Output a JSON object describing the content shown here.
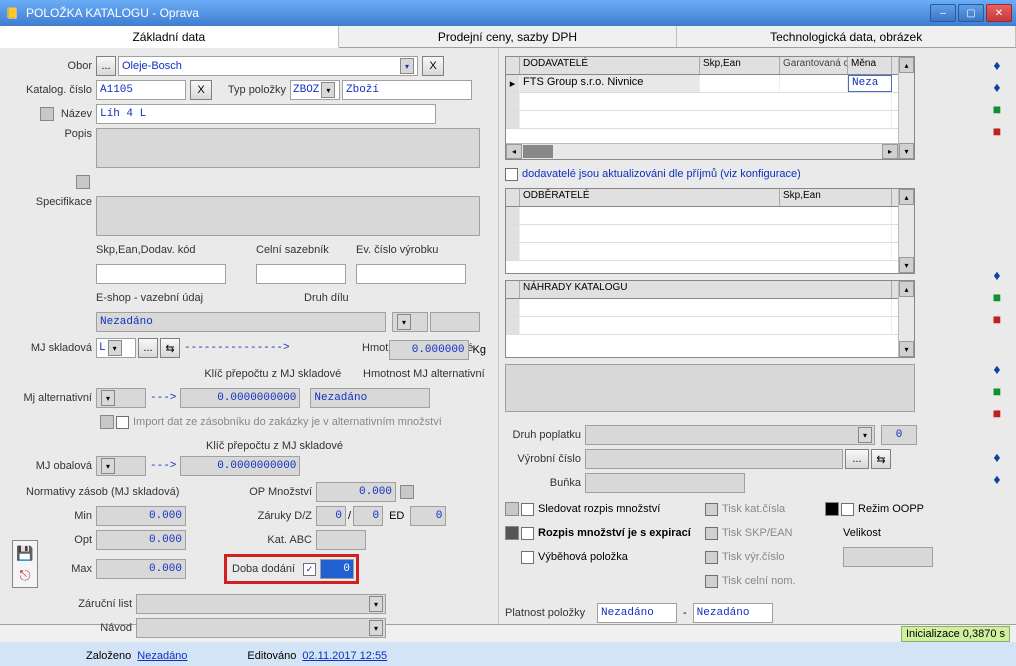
{
  "window": {
    "title": "POLOŽKA KATALOGU - Oprava",
    "min": "–",
    "max": "▢",
    "close": "✕"
  },
  "tabs": {
    "t1": "Základní data",
    "t2": "Prodejní ceny, sazby DPH",
    "t3": "Technologická data, obrázek"
  },
  "left": {
    "obor_lbl": "Obor",
    "obor_btn": "...",
    "obor_val": "Oleje-Bosch",
    "obor_x": "X",
    "kat_lbl": "Katalog. číslo",
    "kat_val": "A1105",
    "kat_x": "X",
    "typ_lbl": "Typ položky",
    "typ_val": "ZBOZ",
    "typ_text": "Zboží",
    "nazev_lbl": "Název",
    "nazev_val": "Líh 4 L",
    "popis_lbl": "Popis",
    "spec_lbl": "Specifikace",
    "skp_lbl": "Skp,Ean,Dodav. kód",
    "celni_lbl": "Celní sazebník",
    "evc_lbl": "Ev. číslo výrobku",
    "eshop_lbl": "E-shop - vazební údaj",
    "eshop_val": "Nezadáno",
    "druh_lbl": "Druh dílu",
    "mjskl_lbl": "MJ skladová",
    "mjskl_val": "L",
    "mjskl_arrow": "--------------->",
    "hmot_lbl": "Hmotnost MJ skladové",
    "hmot_val": "0.000000",
    "hmot_unit": "Kg",
    "klic_lbl": "Klíč přepočtu z MJ skladové",
    "klic_val": "0.0000000000",
    "mjalt_lbl": "Mj alternativní",
    "mjalt_arrow": "--->",
    "hmotalt_lbl": "Hmotnost MJ alternativní",
    "hmotalt_val": "Nezadáno",
    "import_lbl": "Import dat ze zásobníku do zakázky je v alternativním množství",
    "mjobal_lbl": "MJ obalová",
    "mjobal_arrow": "--->",
    "klic2_lbl": "Klíč přepočtu z MJ skladové",
    "klic2_val": "0.0000000000",
    "norm_lbl": "Normativy zásob (MJ skladová)",
    "min_lbl": "Min",
    "min_val": "0.000",
    "opt_lbl": "Opt",
    "opt_val": "0.000",
    "max_lbl": "Max",
    "max_val": "0.000",
    "opmn_lbl": "OP Množství",
    "opmn_val": "0.000",
    "zar_lbl": "Záruky D/Z",
    "zar_a": "0",
    "zar_sep": "/",
    "zar_b": "0",
    "zar_ed": "ED",
    "zar_c": "0",
    "katabc_lbl": "Kat. ABC",
    "doba_lbl": "Doba dodání",
    "doba_val": "0",
    "zlist_lbl": "Záruční list",
    "navod_lbl": "Návod",
    "zaloz_lbl": "Založeno",
    "zaloz_val": "Nezadáno",
    "edit_lbl": "Editováno",
    "edit_val": "02.11.2017 12:55"
  },
  "right": {
    "dod_hdr": "DODAVATELÉ",
    "skpean": "Skp,Ean",
    "garant": "Garantovaná cena",
    "mena": "Měna",
    "dod_row1": "FTS Group s.r.o. Nivnice",
    "dod_mena": "Neza",
    "dod_note": "dodavatelé jsou aktualizováni dle příjmů (viz konfigurace)",
    "odb_hdr": "ODBĚRATELÉ",
    "nahr_hdr": "NÁHRADY KATALOGU",
    "druhp_lbl": "Druh poplatku",
    "druhp_val": "0",
    "vyrc_lbl": "Výrobní číslo",
    "vyrc_btn": "...",
    "bunka_lbl": "Buňka",
    "sled_lbl": "Sledovat rozpis množství",
    "rozp_lbl": "Rozpis množství je s expirací",
    "vybeh_lbl": "Výběhová položka",
    "tisk1": "Tisk kat.čísla",
    "tisk2": "Tisk SKP/EAN",
    "tisk3": "Tisk výr.číslo",
    "tisk4": "Tisk celní nom.",
    "rezim": "Režim OOPP",
    "vel_lbl": "Velikost",
    "plat_lbl": "Platnost položky",
    "plat_a": "Nezadáno",
    "plat_sep": "-",
    "plat_b": "Nezadáno"
  },
  "status": {
    "inic": "Inicializace 0,3870 s"
  }
}
